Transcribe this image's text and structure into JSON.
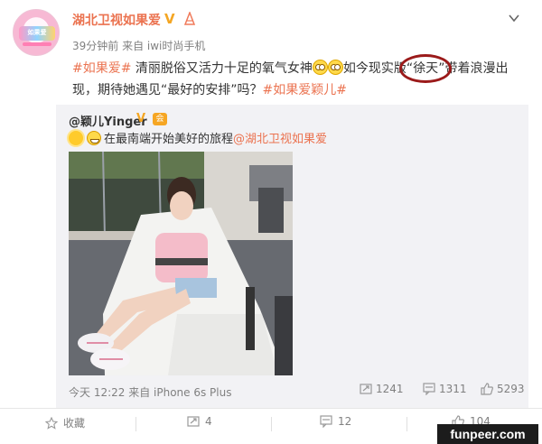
{
  "author": {
    "name": "湖北卫视如果爱",
    "meta": "39分钟前 来自 iwi时尚手机"
  },
  "post": {
    "tag1": "#如果爱#",
    "text1": " 清丽脱俗又活力十足的氧气女神",
    "text2": "如今现实版",
    "quote_open": "“",
    "highlight": "徐天",
    "quote_close": "”",
    "text3": "带着浪漫出现，期待她遇见“最好的安排”吗？",
    "tag2": "#如果爱颖儿#"
  },
  "repost": {
    "user": "@颖儿Yinger",
    "vip": "会",
    "text": "在最南端开始美好的旅程",
    "mention": "@湖北卫视如果爱",
    "meta": "今天 12:22 来自 iPhone 6s Plus",
    "stats": {
      "reposts": "1241",
      "comments": "1311",
      "likes": "5293"
    }
  },
  "actions": {
    "favorite": "收藏",
    "repost": "4",
    "comment": "12",
    "like": "104"
  },
  "watermark": "funpeer.com",
  "colors": {
    "accent": "#eb7350",
    "verified": "#f4a623",
    "highlight_ring": "#9b1a1a"
  }
}
